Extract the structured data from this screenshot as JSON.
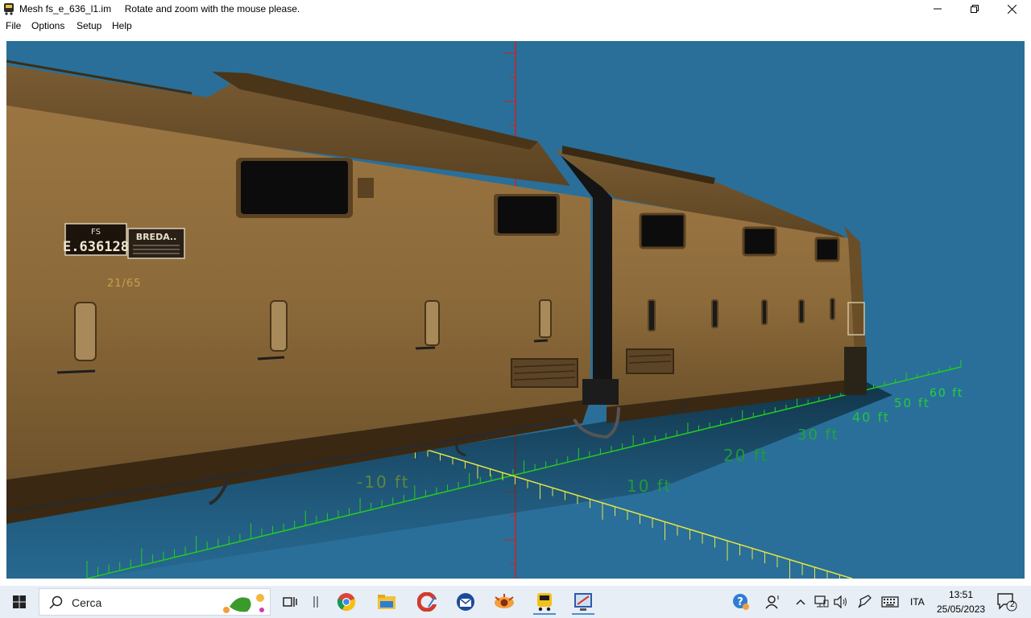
{
  "window": {
    "title": "Mesh fs_e_636_l1.im",
    "hint": "Rotate and zoom with the mouse please.",
    "icon": "train-app-icon"
  },
  "menu": [
    "File",
    "Options",
    "Setup",
    "Help"
  ],
  "scene": {
    "loco_plate": "E.636128",
    "loco_plate_prefix": "FS",
    "builder_plate": "BREDA..",
    "side_mark": "21/65",
    "grid_labels": [
      "-10 ft",
      "10 ft",
      "20 ft",
      "30 ft",
      "40 ft",
      "50 ft",
      "60 ft"
    ],
    "colors": {
      "sky": "#2a6f99",
      "body": "#8a6638",
      "grid_green": "#22cc22",
      "axis_yellow": "#e6e640",
      "axis_red": "#cc2020"
    }
  },
  "taskbar": {
    "search_placeholder": "Cerca",
    "language": "ITA",
    "time": "13:51",
    "date": "25/05/2023",
    "notification_count": "2"
  }
}
